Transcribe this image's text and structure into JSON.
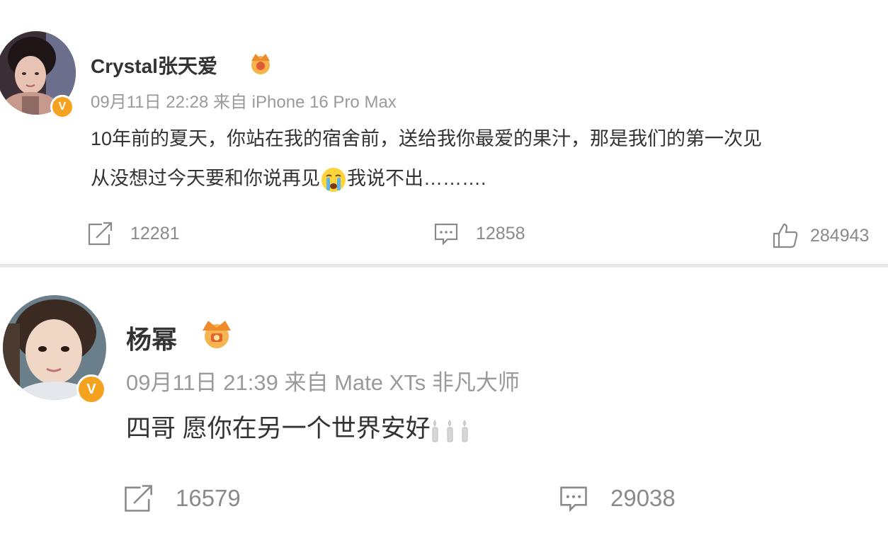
{
  "posts": [
    {
      "author": "Crystal张天爱",
      "meta": "09月11日 22:28 来自 iPhone 16 Pro Max",
      "line1": "10年前的夏天，你站在我的宿舍前，送给我你最爱的果汁，那是我们的第一次见",
      "line2_a": "从没想过今天要和你说再见",
      "line2_b": "我说不出……….",
      "repost_count": "12281",
      "comment_count": "12858",
      "like_count": "284943"
    },
    {
      "author": "杨幂",
      "meta": "09月11日 21:39 来自 Mate XTs 非凡大师",
      "line1": "四哥 愿你在另一个世界安好",
      "repost_count": "16579",
      "comment_count": "29038"
    }
  ],
  "colors": {
    "badge": "#f5a21f",
    "meta_text": "#9a9a9a",
    "body_text": "#333333"
  },
  "icons": [
    "repost-icon",
    "comment-icon",
    "like-icon",
    "verified-badge-icon",
    "crown-icon",
    "crying-emoji-icon",
    "candle-emoji-icon"
  ]
}
